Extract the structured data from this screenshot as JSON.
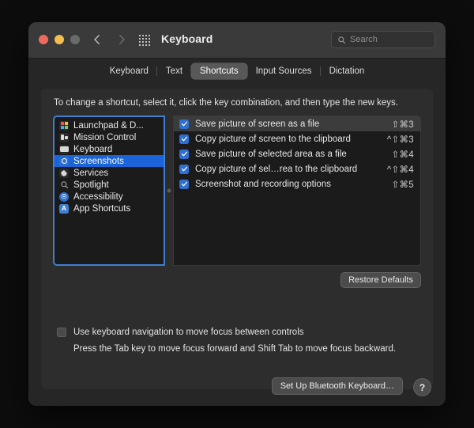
{
  "window": {
    "title": "Keyboard",
    "traffic_lights": [
      "close",
      "minimize",
      "zoom"
    ],
    "nav_back": "‹",
    "nav_forward": "›",
    "grid_icon": "grid-icon",
    "search": {
      "placeholder": "Search",
      "value": ""
    }
  },
  "tabs": [
    {
      "label": "Keyboard",
      "active": false
    },
    {
      "label": "Text",
      "active": false
    },
    {
      "label": "Shortcuts",
      "active": true
    },
    {
      "label": "Input Sources",
      "active": false
    },
    {
      "label": "Dictation",
      "active": false
    }
  ],
  "main": {
    "hint": "To change a shortcut, select it, click the key combination, and then type the new keys.",
    "restore_defaults_label": "Restore Defaults"
  },
  "sidebar": {
    "items": [
      {
        "label": "Launchpad & D...",
        "icon": "launchpad",
        "selected": false
      },
      {
        "label": "Mission Control",
        "icon": "mission",
        "selected": false
      },
      {
        "label": "Keyboard",
        "icon": "keyboard",
        "selected": false
      },
      {
        "label": "Screenshots",
        "icon": "screenshots",
        "selected": true
      },
      {
        "label": "Services",
        "icon": "services",
        "selected": false
      },
      {
        "label": "Spotlight",
        "icon": "spotlight",
        "selected": false
      },
      {
        "label": "Accessibility",
        "icon": "accessibility",
        "selected": false
      },
      {
        "label": "App Shortcuts",
        "icon": "appshortcuts",
        "selected": false
      }
    ]
  },
  "shortcuts": {
    "rows": [
      {
        "label": "Save picture of screen as a file",
        "keys": "⇧⌘3",
        "checked": true,
        "selected": true
      },
      {
        "label": "Copy picture of screen to the clipboard",
        "keys": "^⇧⌘3",
        "checked": true,
        "selected": false
      },
      {
        "label": "Save picture of selected area as a file",
        "keys": "⇧⌘4",
        "checked": true,
        "selected": false
      },
      {
        "label": "Copy picture of sel…rea to the clipboard",
        "keys": "^⇧⌘4",
        "checked": true,
        "selected": false
      },
      {
        "label": "Screenshot and recording options",
        "keys": "⇧⌘5",
        "checked": true,
        "selected": false
      }
    ]
  },
  "keyboard_navigation": {
    "checkbox_label": "Use keyboard navigation to move focus between controls",
    "checked": false,
    "hint": "Press the Tab key to move focus forward and Shift Tab to move focus backward."
  },
  "footer": {
    "bluetooth_label": "Set Up Bluetooth Keyboard…",
    "help_label": "?"
  },
  "colors": {
    "accent_blue": "#1a63d8",
    "checkbox_blue": "#2f6fd0",
    "focus_ring": "#3f7fd0",
    "window_bg": "#262626",
    "panel_bg": "#2d2d2d",
    "list_bg": "#1b1b1b"
  }
}
